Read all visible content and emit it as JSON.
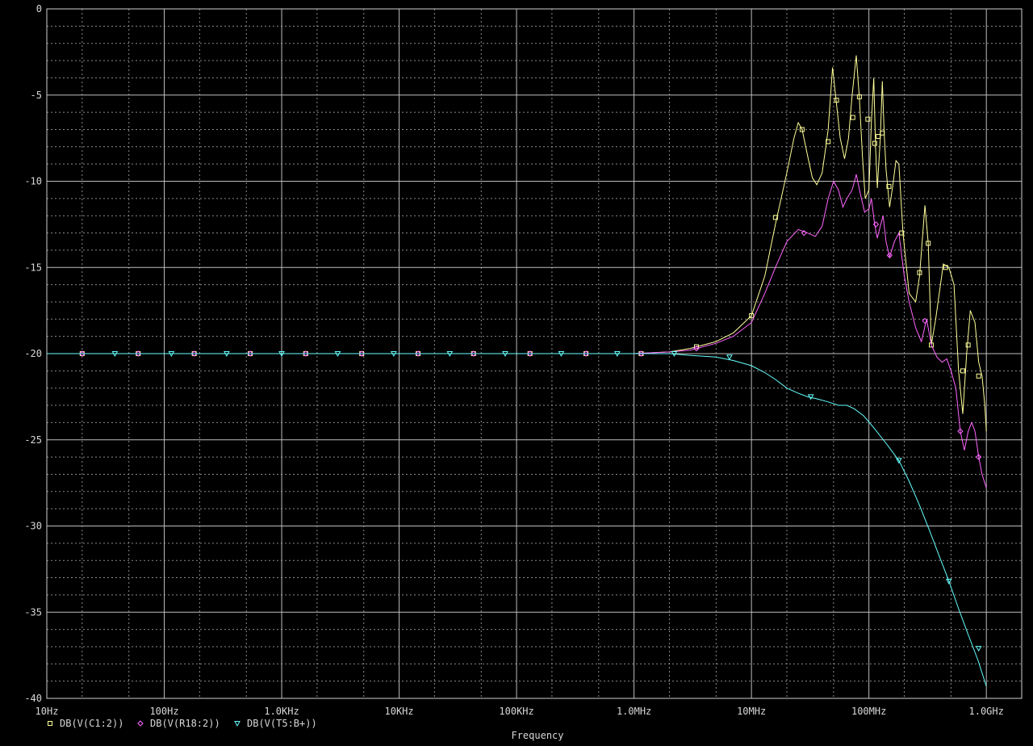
{
  "chart_data": {
    "type": "line",
    "xlabel": "Frequency",
    "ylabel": "",
    "x_scale": "log",
    "xlim": [
      10,
      2000000000
    ],
    "ylim": [
      -40,
      0
    ],
    "grid": true,
    "legend_position": "bottom-left",
    "x_ticks": [
      {
        "v": 10,
        "label": "10Hz"
      },
      {
        "v": 100,
        "label": "100Hz"
      },
      {
        "v": 1000,
        "label": "1.0KHz"
      },
      {
        "v": 10000,
        "label": "10KHz"
      },
      {
        "v": 100000,
        "label": "100KHz"
      },
      {
        "v": 1000000,
        "label": "1.0MHz"
      },
      {
        "v": 10000000,
        "label": "10MHz"
      },
      {
        "v": 100000000,
        "label": "100MHz"
      },
      {
        "v": 1000000000,
        "label": "1.0GHz"
      }
    ],
    "y_ticks": [
      {
        "v": 0,
        "label": "0"
      },
      {
        "v": -5,
        "label": "-5"
      },
      {
        "v": -10,
        "label": "-10"
      },
      {
        "v": -15,
        "label": "-15"
      },
      {
        "v": -20,
        "label": "-20"
      },
      {
        "v": -25,
        "label": "-25"
      },
      {
        "v": -30,
        "label": "-30"
      },
      {
        "v": -35,
        "label": "-35"
      },
      {
        "v": -40,
        "label": "-40"
      }
    ],
    "series": [
      {
        "name": "DB(V(C1:2))",
        "color": "#ffff99",
        "marker": "square",
        "points": [
          [
            10,
            -20
          ],
          [
            1000000,
            -20
          ],
          [
            2000000,
            -19.9
          ],
          [
            3000000,
            -19.7
          ],
          [
            5000000,
            -19.3
          ],
          [
            7000000,
            -18.8
          ],
          [
            10000000,
            -17.8
          ],
          [
            13000000,
            -15.5
          ],
          [
            16000000,
            -12.5
          ],
          [
            20000000,
            -9.5
          ],
          [
            23000000,
            -7.5
          ],
          [
            25000000,
            -6.6
          ],
          [
            27000000,
            -7.0
          ],
          [
            30000000,
            -8.5
          ],
          [
            33000000,
            -9.8
          ],
          [
            36000000,
            -10.2
          ],
          [
            40000000,
            -9.5
          ],
          [
            45000000,
            -7.0
          ],
          [
            49000000,
            -3.4
          ],
          [
            53000000,
            -5.5
          ],
          [
            57000000,
            -7.5
          ],
          [
            62000000,
            -8.7
          ],
          [
            67000000,
            -7.5
          ],
          [
            72000000,
            -5.0
          ],
          [
            78000000,
            -2.7
          ],
          [
            83000000,
            -5.2
          ],
          [
            88000000,
            -8.5
          ],
          [
            93000000,
            -11.0
          ],
          [
            100000000,
            -10.5
          ],
          [
            105000000,
            -6.5
          ],
          [
            110000000,
            -4.0
          ],
          [
            114000000,
            -8.0
          ],
          [
            118000000,
            -10.4
          ],
          [
            125000000,
            -7.5
          ],
          [
            130000000,
            -4.2
          ],
          [
            135000000,
            -7.2
          ],
          [
            140000000,
            -9.3
          ],
          [
            150000000,
            -11.5
          ],
          [
            160000000,
            -10.2
          ],
          [
            170000000,
            -8.8
          ],
          [
            180000000,
            -9.0
          ],
          [
            195000000,
            -13.0
          ],
          [
            220000000,
            -16.5
          ],
          [
            250000000,
            -17.0
          ],
          [
            270000000,
            -15.5
          ],
          [
            300000000,
            -11.4
          ],
          [
            320000000,
            -13.6
          ],
          [
            340000000,
            -19.5
          ],
          [
            370000000,
            -18.0
          ],
          [
            430000000,
            -14.8
          ],
          [
            480000000,
            -15.0
          ],
          [
            530000000,
            -16.0
          ],
          [
            580000000,
            -21.0
          ],
          [
            630000000,
            -23.5
          ],
          [
            680000000,
            -20.0
          ],
          [
            730000000,
            -17.5
          ],
          [
            800000000,
            -18.2
          ],
          [
            860000000,
            -20.5
          ],
          [
            920000000,
            -21.3
          ],
          [
            970000000,
            -23.0
          ],
          [
            1000000000,
            -24.5
          ]
        ],
        "markers": [
          [
            20,
            -20
          ],
          [
            60,
            -20
          ],
          [
            180,
            -20
          ],
          [
            540,
            -20
          ],
          [
            1600,
            -20
          ],
          [
            4800,
            -20
          ],
          [
            14500,
            -20
          ],
          [
            43000,
            -20
          ],
          [
            130000,
            -20
          ],
          [
            390000,
            -20
          ],
          [
            1150000,
            -20
          ],
          [
            3400000,
            -19.6
          ],
          [
            10000000,
            -17.8
          ],
          [
            16000000,
            -12.1
          ],
          [
            27000000,
            -7.0
          ],
          [
            45000000,
            -7.7
          ],
          [
            53000000,
            -5.3
          ],
          [
            73000000,
            -6.3
          ],
          [
            83000000,
            -5.1
          ],
          [
            98000000,
            -6.4
          ],
          [
            112000000,
            -7.8
          ],
          [
            120000000,
            -7.4
          ],
          [
            130000000,
            -7.2
          ],
          [
            148000000,
            -10.3
          ],
          [
            190000000,
            -13.0
          ],
          [
            270000000,
            -15.3
          ],
          [
            320000000,
            -13.6
          ],
          [
            340000000,
            -19.5
          ],
          [
            450000000,
            -15.0
          ],
          [
            630000000,
            -21.0
          ],
          [
            700000000,
            -19.5
          ],
          [
            860000000,
            -21.3
          ]
        ]
      },
      {
        "name": "DB(V(R18:2))",
        "color": "#ff66ff",
        "marker": "diamond",
        "points": [
          [
            10,
            -20
          ],
          [
            1000000,
            -20
          ],
          [
            2000000,
            -19.9
          ],
          [
            3000000,
            -19.8
          ],
          [
            5000000,
            -19.4
          ],
          [
            7000000,
            -19.0
          ],
          [
            10000000,
            -18.2
          ],
          [
            13000000,
            -16.5
          ],
          [
            16000000,
            -15.0
          ],
          [
            20000000,
            -13.5
          ],
          [
            25000000,
            -12.8
          ],
          [
            30000000,
            -13.0
          ],
          [
            35000000,
            -13.2
          ],
          [
            40000000,
            -12.6
          ],
          [
            45000000,
            -11.0
          ],
          [
            50000000,
            -10.0
          ],
          [
            55000000,
            -10.5
          ],
          [
            60000000,
            -11.5
          ],
          [
            65000000,
            -11.0
          ],
          [
            72000000,
            -10.5
          ],
          [
            78000000,
            -9.6
          ],
          [
            85000000,
            -10.8
          ],
          [
            92000000,
            -11.8
          ],
          [
            100000000,
            -11.6
          ],
          [
            105000000,
            -11.0
          ],
          [
            112000000,
            -12.5
          ],
          [
            118000000,
            -13.3
          ],
          [
            125000000,
            -12.6
          ],
          [
            132000000,
            -12.0
          ],
          [
            140000000,
            -13.5
          ],
          [
            150000000,
            -14.4
          ],
          [
            165000000,
            -13.5
          ],
          [
            180000000,
            -13.0
          ],
          [
            200000000,
            -15.5
          ],
          [
            220000000,
            -17.0
          ],
          [
            250000000,
            -18.5
          ],
          [
            280000000,
            -19.3
          ],
          [
            310000000,
            -18.0
          ],
          [
            340000000,
            -19.5
          ],
          [
            380000000,
            -20.2
          ],
          [
            420000000,
            -20.5
          ],
          [
            460000000,
            -20.3
          ],
          [
            500000000,
            -21.0
          ],
          [
            550000000,
            -22.0
          ],
          [
            600000000,
            -24.5
          ],
          [
            650000000,
            -25.6
          ],
          [
            700000000,
            -24.5
          ],
          [
            750000000,
            -24.0
          ],
          [
            800000000,
            -24.5
          ],
          [
            860000000,
            -26.0
          ],
          [
            920000000,
            -27.0
          ],
          [
            1000000000,
            -27.8
          ]
        ],
        "markers": [
          [
            20,
            -20
          ],
          [
            60,
            -20
          ],
          [
            180,
            -20
          ],
          [
            540,
            -20
          ],
          [
            1600,
            -20
          ],
          [
            4800,
            -20
          ],
          [
            14500,
            -20
          ],
          [
            43000,
            -20
          ],
          [
            130000,
            -20
          ],
          [
            390000,
            -20
          ],
          [
            1150000,
            -20
          ],
          [
            3400000,
            -19.7
          ],
          [
            28000000,
            -13.0
          ],
          [
            115000000,
            -12.5
          ],
          [
            150000000,
            -14.3
          ],
          [
            300000000,
            -18.1
          ],
          [
            600000000,
            -24.5
          ],
          [
            860000000,
            -26.0
          ]
        ]
      },
      {
        "name": "DB(V(T5:B+))",
        "color": "#66ffff",
        "marker": "triangle",
        "points": [
          [
            10,
            -20
          ],
          [
            1000000,
            -20
          ],
          [
            2000000,
            -20.0
          ],
          [
            3000000,
            -20.1
          ],
          [
            5000000,
            -20.2
          ],
          [
            7000000,
            -20.4
          ],
          [
            10000000,
            -20.7
          ],
          [
            13000000,
            -21.1
          ],
          [
            16000000,
            -21.5
          ],
          [
            20000000,
            -22.0
          ],
          [
            25000000,
            -22.3
          ],
          [
            30000000,
            -22.5
          ],
          [
            35000000,
            -22.6
          ],
          [
            45000000,
            -22.8
          ],
          [
            55000000,
            -23.0
          ],
          [
            65000000,
            -23.0
          ],
          [
            75000000,
            -23.2
          ],
          [
            90000000,
            -23.6
          ],
          [
            110000000,
            -24.3
          ],
          [
            140000000,
            -25.2
          ],
          [
            180000000,
            -26.2
          ],
          [
            220000000,
            -27.4
          ],
          [
            270000000,
            -28.8
          ],
          [
            330000000,
            -30.3
          ],
          [
            400000000,
            -31.8
          ],
          [
            480000000,
            -33.2
          ],
          [
            580000000,
            -34.8
          ],
          [
            700000000,
            -36.3
          ],
          [
            850000000,
            -37.8
          ],
          [
            1000000000,
            -39.3
          ]
        ],
        "markers": [
          [
            38,
            -20
          ],
          [
            115,
            -20
          ],
          [
            340,
            -20
          ],
          [
            1000,
            -20
          ],
          [
            3000,
            -20
          ],
          [
            9000,
            -20
          ],
          [
            27000,
            -20
          ],
          [
            80000,
            -20
          ],
          [
            240000,
            -20
          ],
          [
            720000,
            -20
          ],
          [
            2200000,
            -20.0
          ],
          [
            6500000,
            -20.2
          ],
          [
            32000000,
            -22.5
          ],
          [
            180000000,
            -26.2
          ],
          [
            480000000,
            -33.2
          ],
          [
            860000000,
            -37.1
          ]
        ]
      }
    ]
  }
}
